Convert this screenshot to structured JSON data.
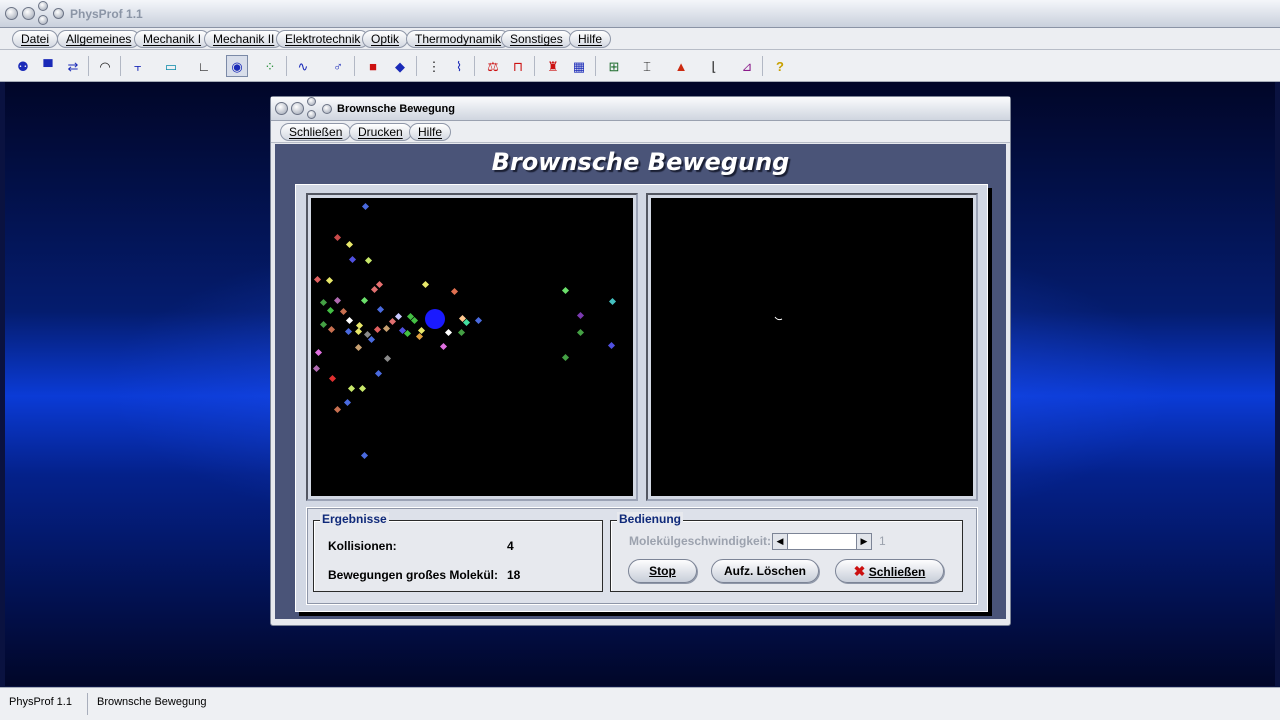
{
  "app": {
    "title": "PhysProf 1.1"
  },
  "menubar": {
    "items": [
      {
        "label": "Datei"
      },
      {
        "label": "Allgemeines"
      },
      {
        "label": "Mechanik I"
      },
      {
        "label": "Mechanik II"
      },
      {
        "label": "Elektrotechnik"
      },
      {
        "label": "Optik"
      },
      {
        "label": "Thermodynamik"
      },
      {
        "label": "Sonstiges"
      },
      {
        "label": "Hilfe"
      }
    ]
  },
  "toolbar": {
    "icons": [
      "molecules-icon",
      "balance-icon",
      "exchange-icon",
      "curve-icon",
      "level-icon",
      "pump-icon",
      "graph-icon",
      "eye-icon",
      "dots-icon",
      "wave-icon",
      "gender-icon",
      "weight-icon",
      "magnet-icon",
      "bar-icon",
      "graph2-icon",
      "scale-icon",
      "frame-icon",
      "figure-icon",
      "chart-icon",
      "transistor-icon",
      "resistor-icon",
      "triangle-icon",
      "distribution-icon",
      "spectrum-icon",
      "help-icon"
    ]
  },
  "window": {
    "title": "Brownsche Bewegung",
    "menu": [
      {
        "label": "Schließen"
      },
      {
        "label": "Drucken"
      },
      {
        "label": "Hilfe"
      }
    ],
    "heading": "Brownsche Bewegung",
    "results": {
      "legend": "Ergebnisse",
      "collisions_label": "Kollisionen:",
      "collisions_value": "4",
      "moves_label": "Bewegungen großes Molekül:",
      "moves_value": "18"
    },
    "controls": {
      "legend": "Bedienung",
      "speed_label": "Molekülgeschwindigkeit:",
      "speed_value": "1",
      "stop_label": "Stop",
      "clear_label": "Aufz. Löschen",
      "close_label": "Schließen"
    }
  },
  "statusbar": {
    "app": "PhysProf 1.1",
    "module": "Brownsche Bewegung"
  },
  "colors": {
    "desktop_accent": "#0b3bd6",
    "big_molecule": "#1a1aff",
    "heading_text": "#ffffff",
    "legend_text": "#102a7a",
    "close_x": "#cc1010"
  }
}
